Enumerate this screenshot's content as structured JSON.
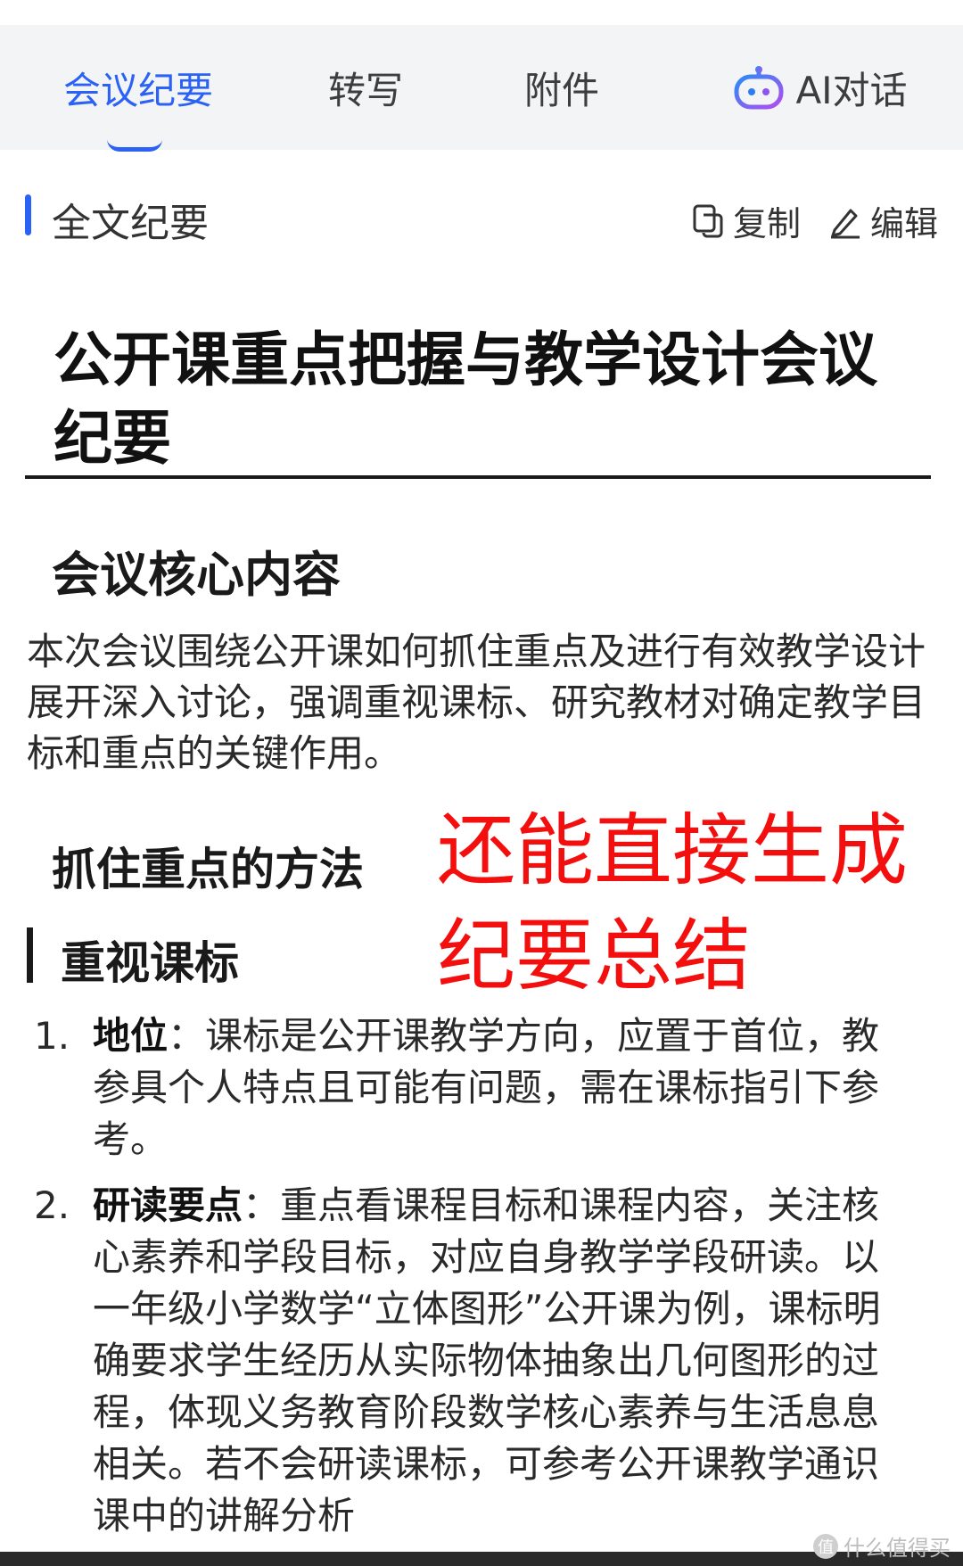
{
  "tabs": {
    "minutes": "会议纪要",
    "transcript": "转写",
    "attachments": "附件",
    "ai_chat": "AI对话"
  },
  "section": {
    "title": "全文纪要",
    "copy_label": "复制",
    "edit_label": "编辑"
  },
  "doc": {
    "title": "公开课重点把握与教学设计会议纪要",
    "core_heading": "会议核心内容",
    "core_text": "本次会议围绕公开课如何抓住重点及进行有效教学设计展开深入讨论，强调重视课标、研究教材对确定教学目标和重点的关键作用。",
    "method_heading": "抓住重点的方法",
    "subheading": "重视课标",
    "items": [
      {
        "num": "1.",
        "bold": "地位",
        "text": "：课标是公开课教学方向，应置于首位，教参具个人特点且可能有问题，需在课标指引下参考。"
      },
      {
        "num": "2.",
        "bold": "研读要点",
        "text": "：重点看课程目标和课程内容，关注核心素养和学段目标，对应自身教学学段研读。以一年级小学数学“立体图形”公开课为例，课标明确要求学生经历从实际物体抽象出几何图形的过程，体现义务教育阶段数学核心素养与生活息息相关。若不会研读课标，可参考公开课教学通识课中的讲解分析"
      }
    ]
  },
  "overlay_text": "还能直接生成纪要总结",
  "watermark": "什么值得买",
  "colors": {
    "accent": "#2b62f5",
    "overlay": "#f40f0f"
  }
}
